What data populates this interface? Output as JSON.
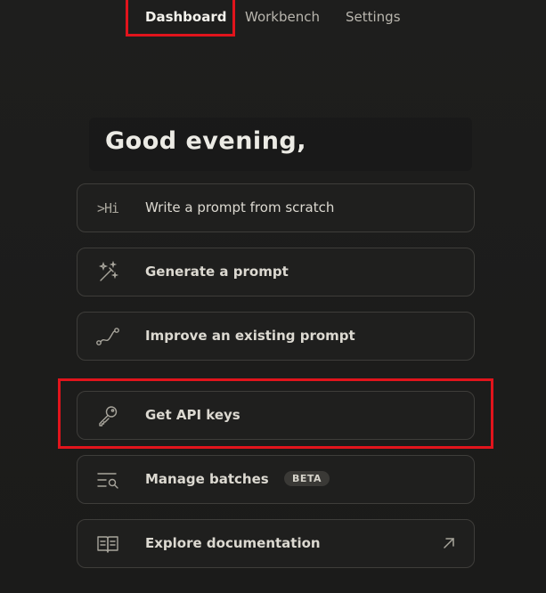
{
  "nav": {
    "tabs": [
      {
        "label": "Dashboard",
        "active": true
      },
      {
        "label": "Workbench",
        "active": false
      },
      {
        "label": "Settings",
        "active": false
      }
    ]
  },
  "greeting": "Good evening,",
  "actions": [
    {
      "label": "Write a prompt from scratch",
      "icon": "prompt-hi-icon",
      "icon_text": ">Hi"
    },
    {
      "label": "Generate a prompt",
      "icon": "magic-wand-icon"
    },
    {
      "label": "Improve an existing prompt",
      "icon": "curve-path-icon"
    },
    {
      "label": "Get API keys",
      "icon": "key-icon"
    },
    {
      "label": "Manage batches",
      "icon": "list-search-icon",
      "badge": "BETA"
    },
    {
      "label": "Explore documentation",
      "icon": "book-icon",
      "trailing_icon": "external-link-arrow-icon"
    }
  ],
  "colors": {
    "background": "#1f1f1e",
    "card_border": "#3e3d3a",
    "highlight": "#e1141c",
    "text": "#dcd9d1"
  }
}
